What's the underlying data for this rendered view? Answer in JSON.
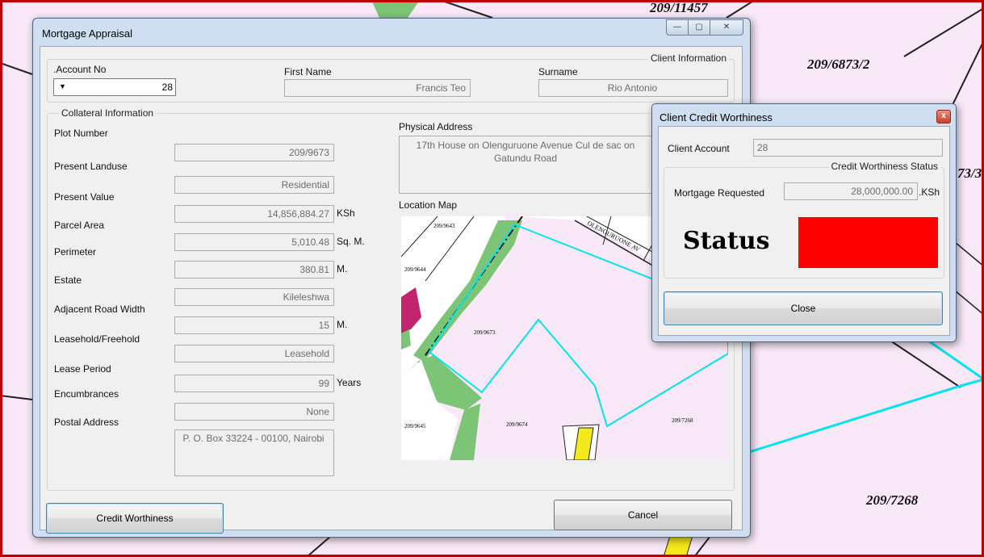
{
  "background": {
    "labels": [
      "209/11457",
      "209/6873/2",
      "73/3",
      "209/7268"
    ]
  },
  "main_window": {
    "title": "Mortgage Appraisal",
    "controls": {
      "minimize": "—",
      "maximize": "▢",
      "close": "✕"
    },
    "client_info": {
      "caption": "Client Information",
      "account_label": ".Account No",
      "account_value": "28",
      "first_name_label": "First Name",
      "first_name_value": "Francis Teo",
      "surname_label": "Surname",
      "surname_value": "Rio Antonio"
    },
    "collateral": {
      "caption": "Collateral Information",
      "fields": [
        {
          "label": "Plot Number",
          "value": "209/9673",
          "unit": ""
        },
        {
          "label": "Present Landuse",
          "value": "Residential",
          "unit": ""
        },
        {
          "label": "Present Value",
          "value": "14,856,884.27",
          "unit": "KSh"
        },
        {
          "label": "Parcel Area",
          "value": "5,010.48",
          "unit": "Sq. M."
        },
        {
          "label": "Perimeter",
          "value": "380.81",
          "unit": "M."
        },
        {
          "label": "Estate",
          "value": "Kileleshwa",
          "unit": ""
        },
        {
          "label": "Adjacent Road Width",
          "value": "15",
          "unit": "M."
        },
        {
          "label": "Leasehold/Freehold",
          "value": "Leasehold",
          "unit": ""
        },
        {
          "label": "Lease Period",
          "value": "99",
          "unit": "Years"
        },
        {
          "label": "Encumbrances",
          "value": "None",
          "unit": ""
        }
      ],
      "postal_label": "Postal Address",
      "postal_value": "P. O. Box 33224 - 00100, Nairobi",
      "physical_label": "Physical Address",
      "physical_value": "17th House on Olenguruone Avenue Cul de sac on Gatundu Road",
      "map_label": "Location Map",
      "map_labels": [
        "209/9643",
        "209/9644",
        "209/9673",
        "209/9645",
        "209/9674",
        "209/7268",
        "OLENGURUONE AV"
      ]
    },
    "buttons": {
      "credit": "Credit Worthiness",
      "cancel": "Cancel"
    }
  },
  "dialog": {
    "title": "Client Credit Worthiness",
    "close_x": "x",
    "client_account_label": "Client Account",
    "client_account_value": "28",
    "status_group_caption": "Credit Worthiness Status",
    "mortgage_label": "Mortgage Requested",
    "mortgage_value": "28,000,000.00",
    "mortgage_unit": ".KSh",
    "status_label": "Status",
    "status_color": "#ff0000",
    "close_button": "Close"
  }
}
